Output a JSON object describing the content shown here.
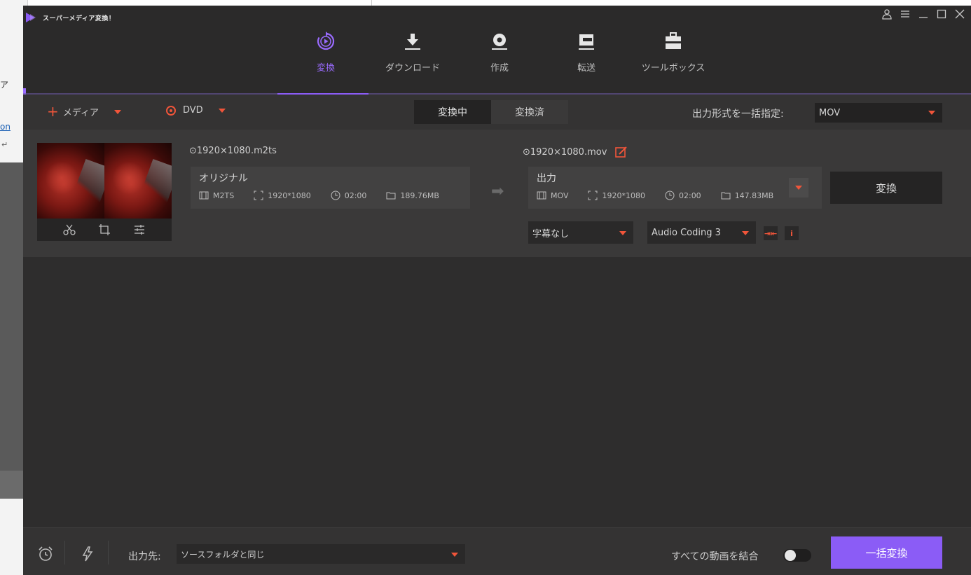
{
  "background_window": {
    "text1": "ア",
    "text2": "on",
    "text3": "↵"
  },
  "app": {
    "title": "スーパーメディア変換！",
    "accent_color": "#8b5cf6",
    "highlight_color": "#f0553a",
    "window_controls": [
      "account-icon",
      "menu-icon",
      "minimize-icon",
      "maximize-icon",
      "close-icon"
    ]
  },
  "nav": {
    "items": [
      {
        "label": "変換",
        "icon": "convert-icon",
        "active": true
      },
      {
        "label": "ダウンロード",
        "icon": "download-icon",
        "active": false
      },
      {
        "label": "作成",
        "icon": "burn-icon",
        "active": false
      },
      {
        "label": "転送",
        "icon": "transfer-icon",
        "active": false
      },
      {
        "label": "ツールボックス",
        "icon": "toolbox-icon",
        "active": false
      }
    ]
  },
  "toolbar": {
    "add_media": "メディア",
    "dvd": "DVD",
    "tabs": [
      {
        "label": "変換中",
        "active": true
      },
      {
        "label": "変換済",
        "active": false
      }
    ],
    "output_format_label": "出力形式を一括指定:",
    "output_format_value": "MOV"
  },
  "file": {
    "source_name": "⊙1920×1080.m2ts",
    "source_title": "オリジナル",
    "source_meta": {
      "format": "M2TS",
      "resolution": "1920*1080",
      "duration": "02:00",
      "size": "189.76MB"
    },
    "output_name": "⊙1920×1080.mov",
    "output_title": "出力",
    "output_meta": {
      "format": "MOV",
      "resolution": "1920*1080",
      "duration": "02:00",
      "size": "147.83MB"
    },
    "convert_label": "変換",
    "subtitle_value": "字幕なし",
    "audio_value": "Audio Coding 3",
    "thumb_tools": [
      "cut-icon",
      "crop-icon",
      "effects-icon"
    ]
  },
  "bottom": {
    "output_label": "出力先:",
    "output_value": "ソースフォルダと同じ",
    "merge_label": "すべての動画を結合",
    "merge_on": false,
    "batch_label": "一括変換"
  }
}
